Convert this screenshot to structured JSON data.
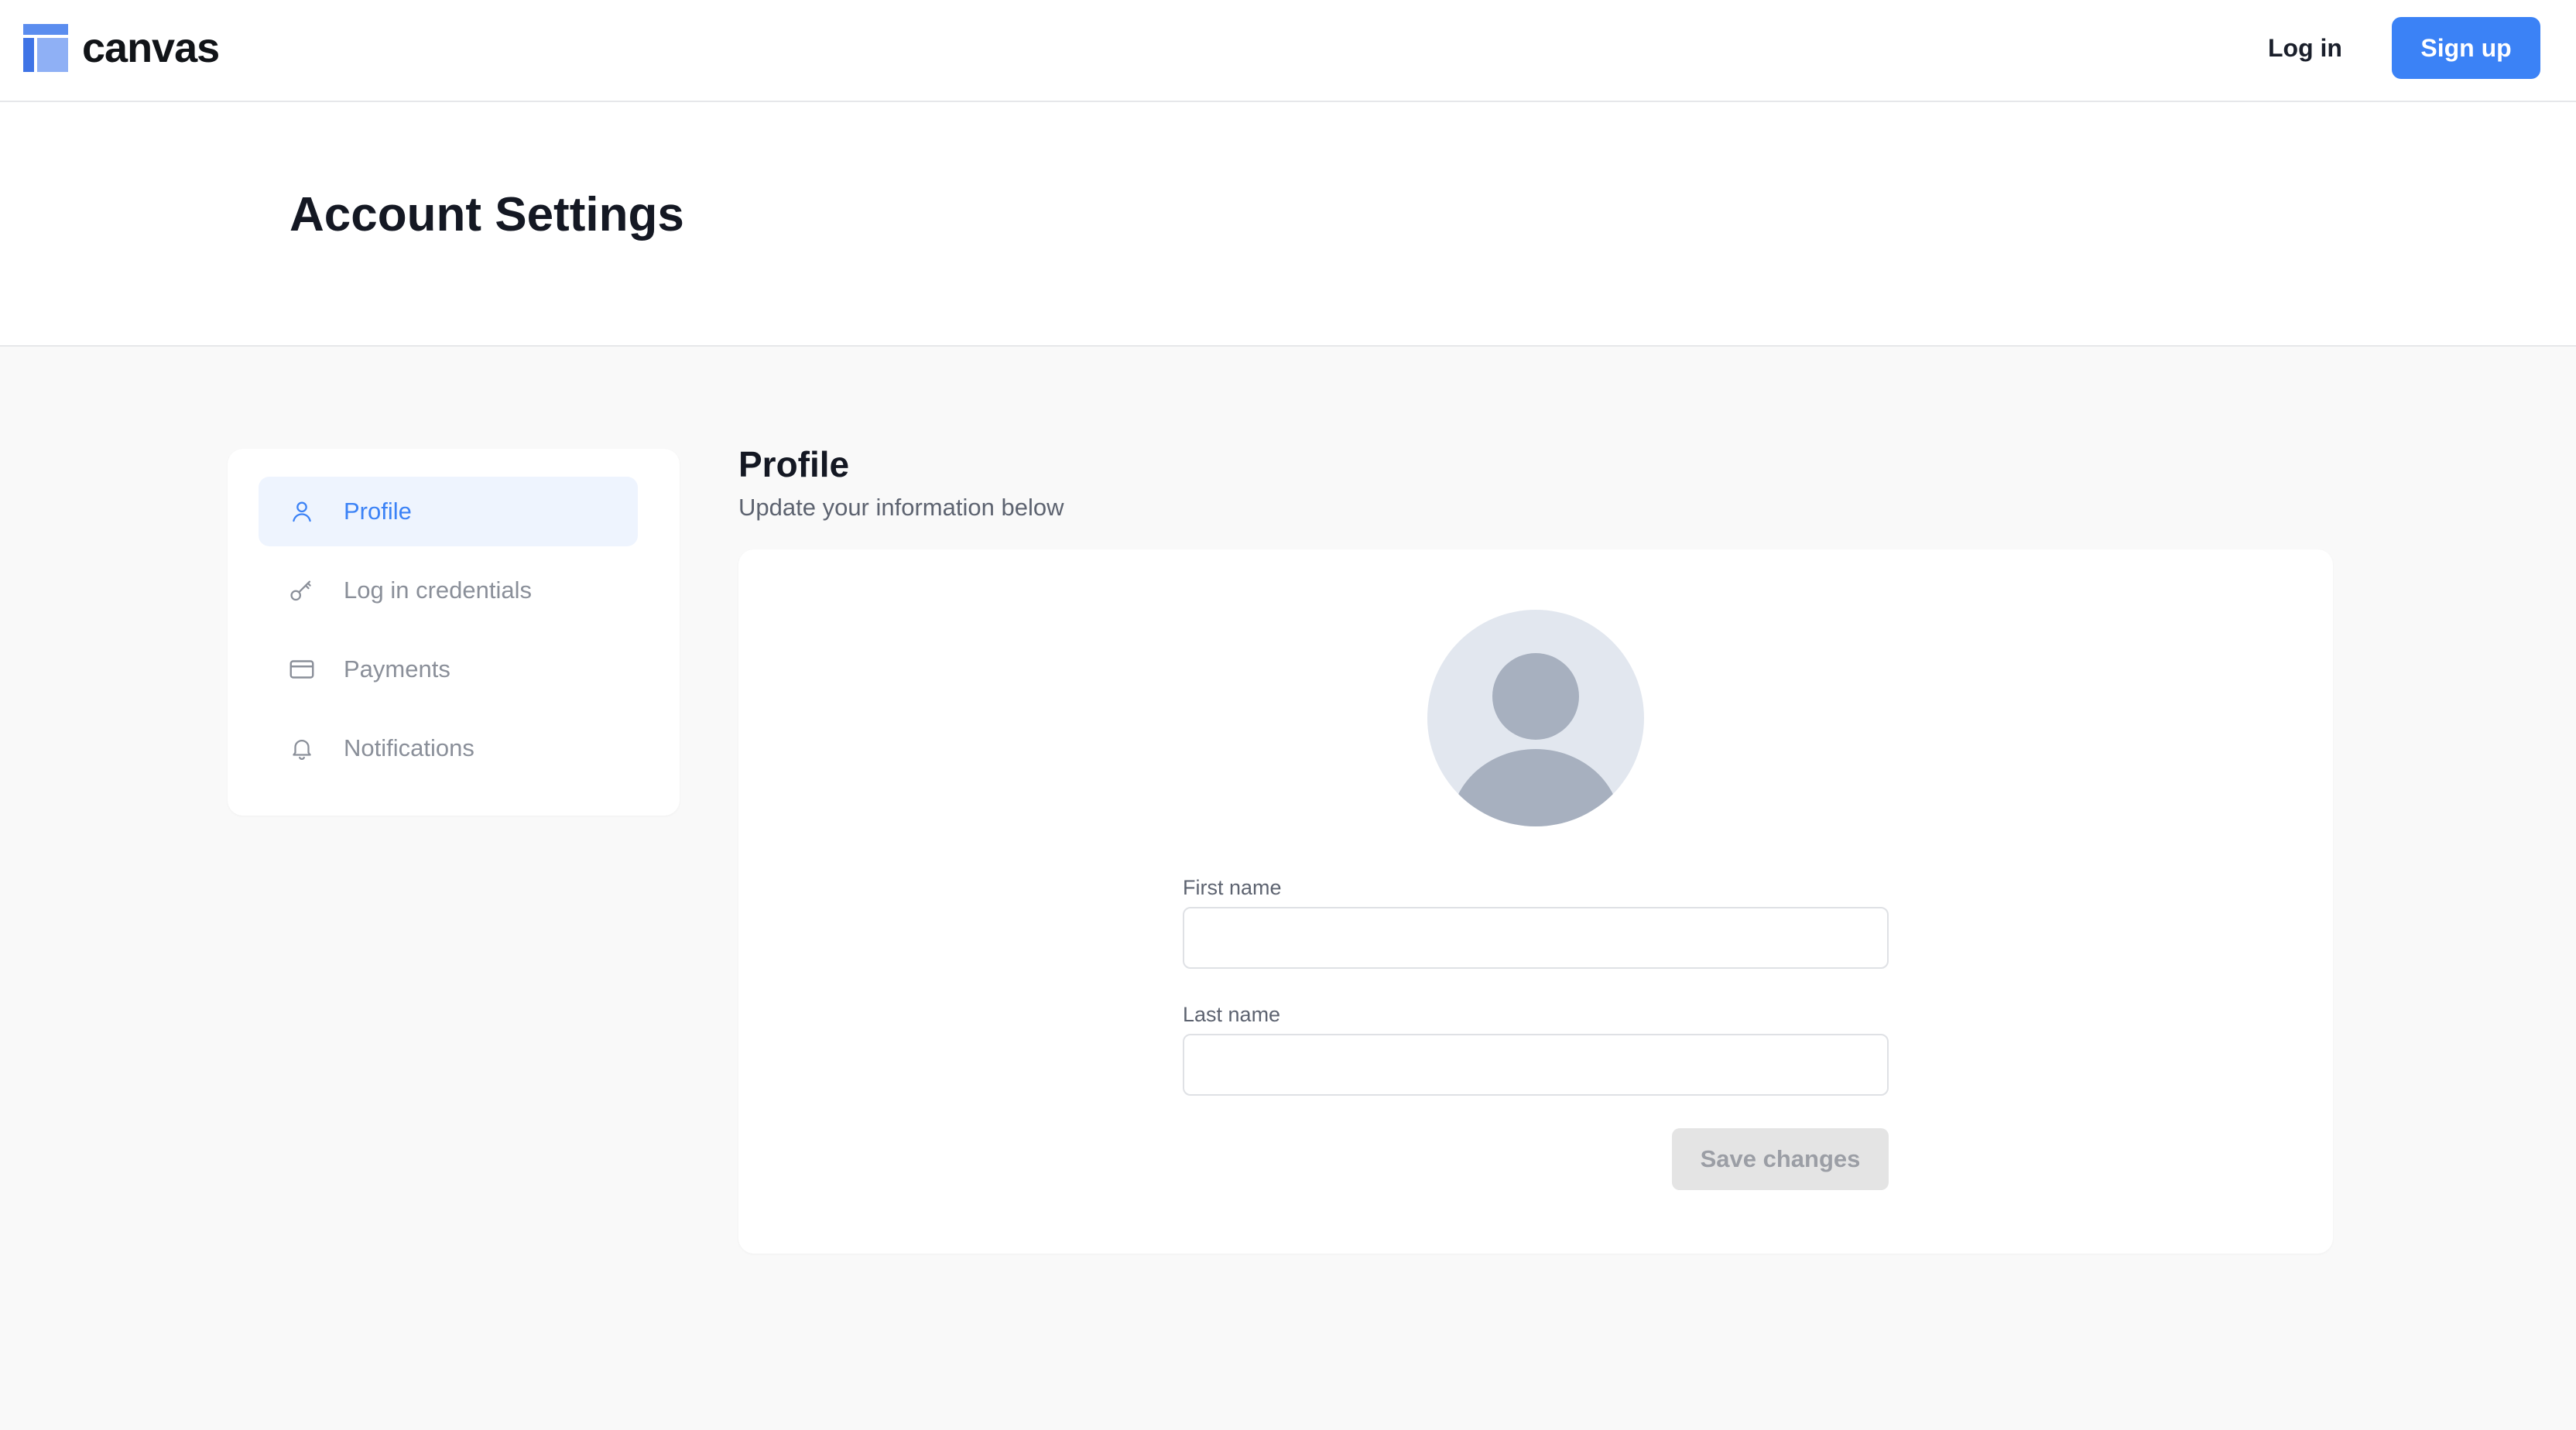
{
  "brand": {
    "name": "canvas",
    "logo_icon": "canvas-logo-icon",
    "accent_color": "#3b82f6"
  },
  "topbar": {
    "login_label": "Log in",
    "signup_label": "Sign up"
  },
  "page": {
    "title": "Account Settings"
  },
  "sidebar": {
    "items": [
      {
        "label": "Profile",
        "icon": "user-icon",
        "active": true
      },
      {
        "label": "Log in credentials",
        "icon": "key-icon",
        "active": false
      },
      {
        "label": "Payments",
        "icon": "credit-card-icon",
        "active": false
      },
      {
        "label": "Notifications",
        "icon": "bell-icon",
        "active": false
      }
    ]
  },
  "profile": {
    "title": "Profile",
    "subtitle": "Update your information below",
    "avatar_icon": "avatar-placeholder-icon",
    "first_name": {
      "label": "First name",
      "value": "",
      "placeholder": ""
    },
    "last_name": {
      "label": "Last name",
      "value": "",
      "placeholder": ""
    },
    "save_label": "Save changes"
  }
}
